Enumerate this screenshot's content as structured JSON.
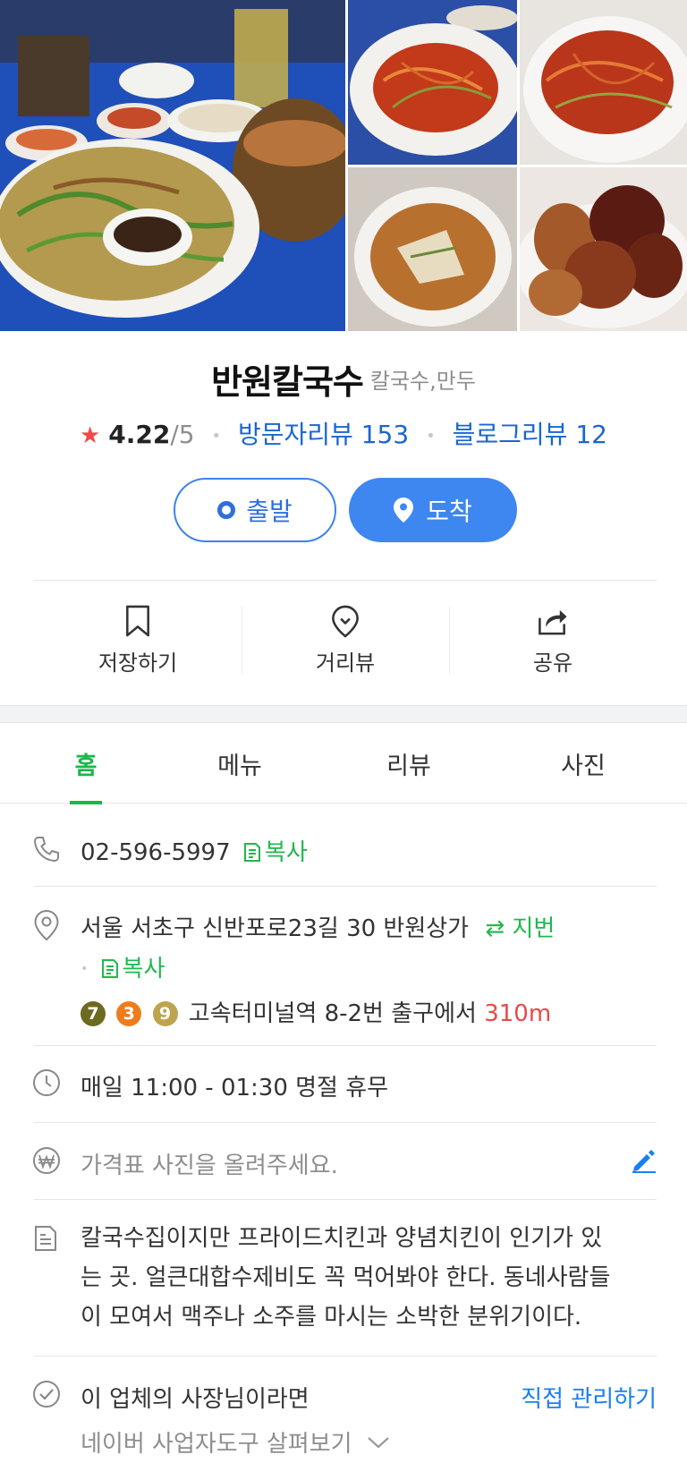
{
  "place": {
    "name": "반원칼국수",
    "category": "칼국수,만두",
    "rating": "4.22",
    "rating_max": "/5",
    "visitor_reviews_label": "방문자리뷰 153",
    "blog_reviews_label": "블로그리뷰 12"
  },
  "buttons": {
    "start": "출발",
    "arrive": "도착"
  },
  "actions": {
    "save": "저장하기",
    "street_view": "거리뷰",
    "share": "공유"
  },
  "tabs": [
    {
      "label": "홈",
      "active": true
    },
    {
      "label": "메뉴",
      "active": false
    },
    {
      "label": "리뷰",
      "active": false
    },
    {
      "label": "사진",
      "active": false
    }
  ],
  "info": {
    "phone": "02-596-5997",
    "copy_label": "복사",
    "address": "서울 서초구 신반포로23길 30 반원상가",
    "jibun_label": "지번",
    "subway_lines": [
      {
        "num": "7",
        "color": "#6b6a1f"
      },
      {
        "num": "3",
        "color": "#ef7c1c"
      },
      {
        "num": "9",
        "color": "#bda44d"
      }
    ],
    "station_text": "고속터미널역 8-2번 출구에서",
    "distance": "310m",
    "hours": "매일 11:00 - 01:30 명절 휴무",
    "price_prompt": "가격표 사진을 올려주세요.",
    "description_lines": [
      "칼국수집이지만 프라이드치킨과 양념치킨이 인기가 있",
      "는 곳. 얼큰대합수제비도 꼭 먹어봐야 한다. 동네사람들",
      "이 모여서 맥주나 소주를 마시는 소박한 분위기이다."
    ],
    "owner_prompt": "이 업체의 사장님이라면",
    "manage_link": "직접 관리하기",
    "biz_tools": "네이버 사업자도구 살펴보기"
  },
  "colors": {
    "accent_green": "#18b84a",
    "link_blue": "#1a66d0",
    "button_blue": "#3e87f0",
    "star_red": "#f04a4a"
  }
}
